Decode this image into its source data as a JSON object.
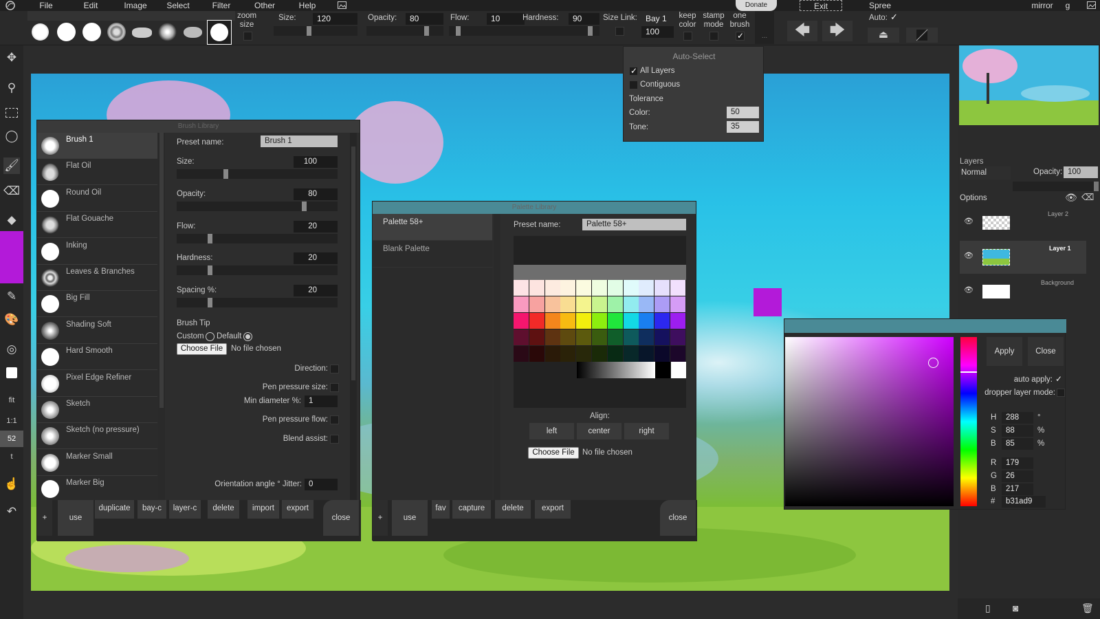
{
  "menubar": {
    "items": [
      "File",
      "Edit",
      "Image",
      "Select",
      "Filter",
      "Other",
      "Help"
    ],
    "donate": "Donate",
    "exit": "Exit",
    "spree": "Spree",
    "mirror": "mirror",
    "g": "g"
  },
  "toolbar": {
    "zoom_size": "zoom size",
    "size_label": "Size:",
    "size_value": "120",
    "opacity_label": "Opacity:",
    "opacity_value": "80",
    "flow_label": "Flow:",
    "flow_value": "10",
    "hardness_label": "Hardness:",
    "hardness_value": "90",
    "size_link_label": "Size Link:",
    "size_link_value": "Bay 1",
    "size_link_num": "100",
    "keep_color": "keep color",
    "stamp_mode": "stamp mode",
    "one_brush": "one brush",
    "auto_label": "Auto:",
    "ellipsis": "...",
    "levels": {
      "size": 0.42,
      "opacity": 0.8,
      "flow": 0.1,
      "hardness": 0.9
    }
  },
  "left_tools": {
    "fit": "fit",
    "one_to_one": "1:1",
    "zoom": "52",
    "t": "t",
    "accent": "#b31ad9"
  },
  "brush_library": {
    "title": "Brush Library",
    "items": [
      "Brush 1",
      "Flat Oil",
      "Round Oil",
      "Flat Gouache",
      "Inking",
      "Leaves & Branches",
      "Big Fill",
      "Shading Soft",
      "Hard Smooth",
      "Pixel Edge Refiner",
      "Sketch",
      "Sketch (no pressure)",
      "Marker Small",
      "Marker Big"
    ],
    "preset_label": "Preset name:",
    "preset_value": "Brush 1",
    "size_label": "Size:",
    "size_value": "100",
    "opacity_label": "Opacity:",
    "opacity_value": "80",
    "flow_label": "Flow:",
    "flow_value": "20",
    "hardness_label": "Hardness:",
    "hardness_value": "20",
    "spacing_label": "Spacing %:",
    "spacing_value": "20",
    "levels": {
      "size": 0.3,
      "opacity": 0.8,
      "flow": 0.2,
      "hardness": 0.2,
      "spacing": 0.2
    },
    "brush_tip": "Brush Tip",
    "custom": "Custom",
    "default": "Default",
    "choose_file": "Choose File",
    "no_file": "No file chosen",
    "direction": "Direction:",
    "pen_pressure_size": "Pen pressure size:",
    "min_diameter": "Min diameter %:",
    "min_diameter_value": "1",
    "pen_pressure_flow": "Pen pressure flow:",
    "blend_assist": "Blend assist:",
    "orientation_jitter": "Orientation angle ° Jitter:",
    "jitter_value": "0",
    "buttons": {
      "plus": "+",
      "use": "use",
      "duplicate": "duplicate",
      "bay_c": "bay-c",
      "layer_c": "layer-c",
      "delete": "delete",
      "import": "import",
      "export": "export",
      "close": "close"
    }
  },
  "palette_library": {
    "title": "Palette Library",
    "items": [
      "Palette 58+",
      "Blank Palette"
    ],
    "preset_label": "Preset name:",
    "preset_value": "Palette 58+",
    "align_label": "Align:",
    "align": [
      "left",
      "center",
      "right"
    ],
    "choose_file": "Choose File",
    "no_file": "No file chosen",
    "buttons": {
      "plus": "+",
      "use": "use",
      "fav": "fav",
      "capture": "capture",
      "delete": "delete",
      "export": "export",
      "close": "close"
    },
    "rows": [
      [
        "#fde3e5",
        "#fde4e0",
        "#fdebe0",
        "#fdf3e0",
        "#fbfbe0",
        "#effde0",
        "#e2fde6",
        "#e0fbfb",
        "#e0ecfd",
        "#e6e0fd",
        "#f2e0fd"
      ],
      [
        "#f99abf",
        "#f7a2a0",
        "#f8c29c",
        "#f9dd92",
        "#f4f48e",
        "#c9f48e",
        "#9ef2a8",
        "#92ecef",
        "#99b8f6",
        "#ac9cf6",
        "#d59cf6"
      ],
      [
        "#f5166e",
        "#f22a28",
        "#f4861c",
        "#f7bb12",
        "#f2ef0e",
        "#8cee0f",
        "#20e63c",
        "#13d9e5",
        "#1a7ff0",
        "#2c28f0",
        "#9d1ef0"
      ],
      [
        "#5e0f2e",
        "#5e1111",
        "#5e3311",
        "#5e4a0f",
        "#5c5a0d",
        "#3a5c0f",
        "#105e2a",
        "#0e5a5c",
        "#0f2e5e",
        "#15115e",
        "#3e0e5e"
      ],
      [
        "#2a0916",
        "#2a0808",
        "#2a1a08",
        "#2a2208",
        "#28280a",
        "#1a2a08",
        "#082a14",
        "#082829",
        "#08162a",
        "#0b082a",
        "#1c072a"
      ]
    ]
  },
  "auto_select": {
    "title": "Auto-Select",
    "all_layers": "All Layers",
    "contiguous": "Contiguous",
    "tolerance": "Tolerance",
    "color_label": "Color:",
    "color_value": "50",
    "tone_label": "Tone:",
    "tone_value": "35"
  },
  "layers": {
    "title": "Layers",
    "mode": "Normal",
    "opacity_label": "Opacity:",
    "opacity_value": "100",
    "options": "Options",
    "items": [
      "Layer 2",
      "Layer 1",
      "Background"
    ]
  },
  "color_picker": {
    "apply": "Apply",
    "close": "Close",
    "auto_apply": "auto apply:",
    "dropper_mode": "dropper layer mode:",
    "h_label": "H",
    "h": "288",
    "h_unit": "°",
    "s_label": "S",
    "s": "88",
    "s_unit": "%",
    "b_label": "B",
    "b": "85",
    "b_unit": "%",
    "r_label": "R",
    "r": "179",
    "g_label": "G",
    "g": "26",
    "bb_label": "B",
    "bb": "217",
    "hex_label": "#",
    "hex": "b31ad9",
    "color": "#b31ad9"
  }
}
